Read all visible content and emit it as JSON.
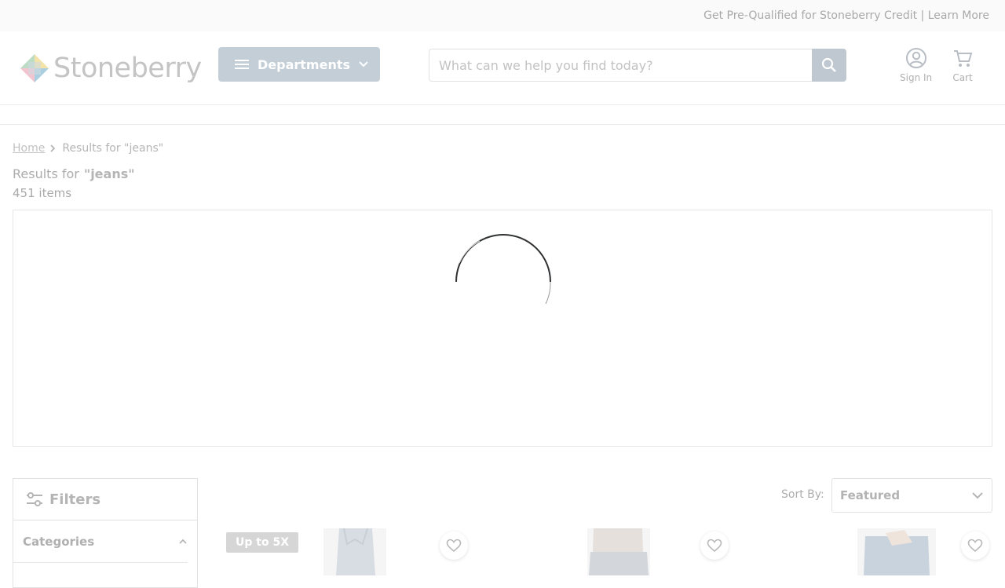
{
  "promo": {
    "text": "Get Pre-Qualified for Stoneberry Credit | Learn More"
  },
  "header": {
    "logo_text": "Stoneberry",
    "departments_label": "Departments",
    "search_placeholder": "What can we help you find today?",
    "sign_in_label": "Sign In",
    "cart_label": "Cart"
  },
  "breadcrumb": {
    "home": "Home",
    "current": "Results for  \"jeans\""
  },
  "results": {
    "prefix": "Results for",
    "query": "\"jeans\"",
    "count": "451 items"
  },
  "filters": {
    "title": "Filters",
    "categories_label": "Categories"
  },
  "sort": {
    "label": "Sort By:",
    "selected": "Featured"
  },
  "products": [
    {
      "badge": "Up to 5X"
    },
    {
      "badge": ""
    },
    {
      "badge": ""
    }
  ],
  "colors": {
    "dept_button": "#c3ced7",
    "search_button": "#bfc8d0"
  }
}
